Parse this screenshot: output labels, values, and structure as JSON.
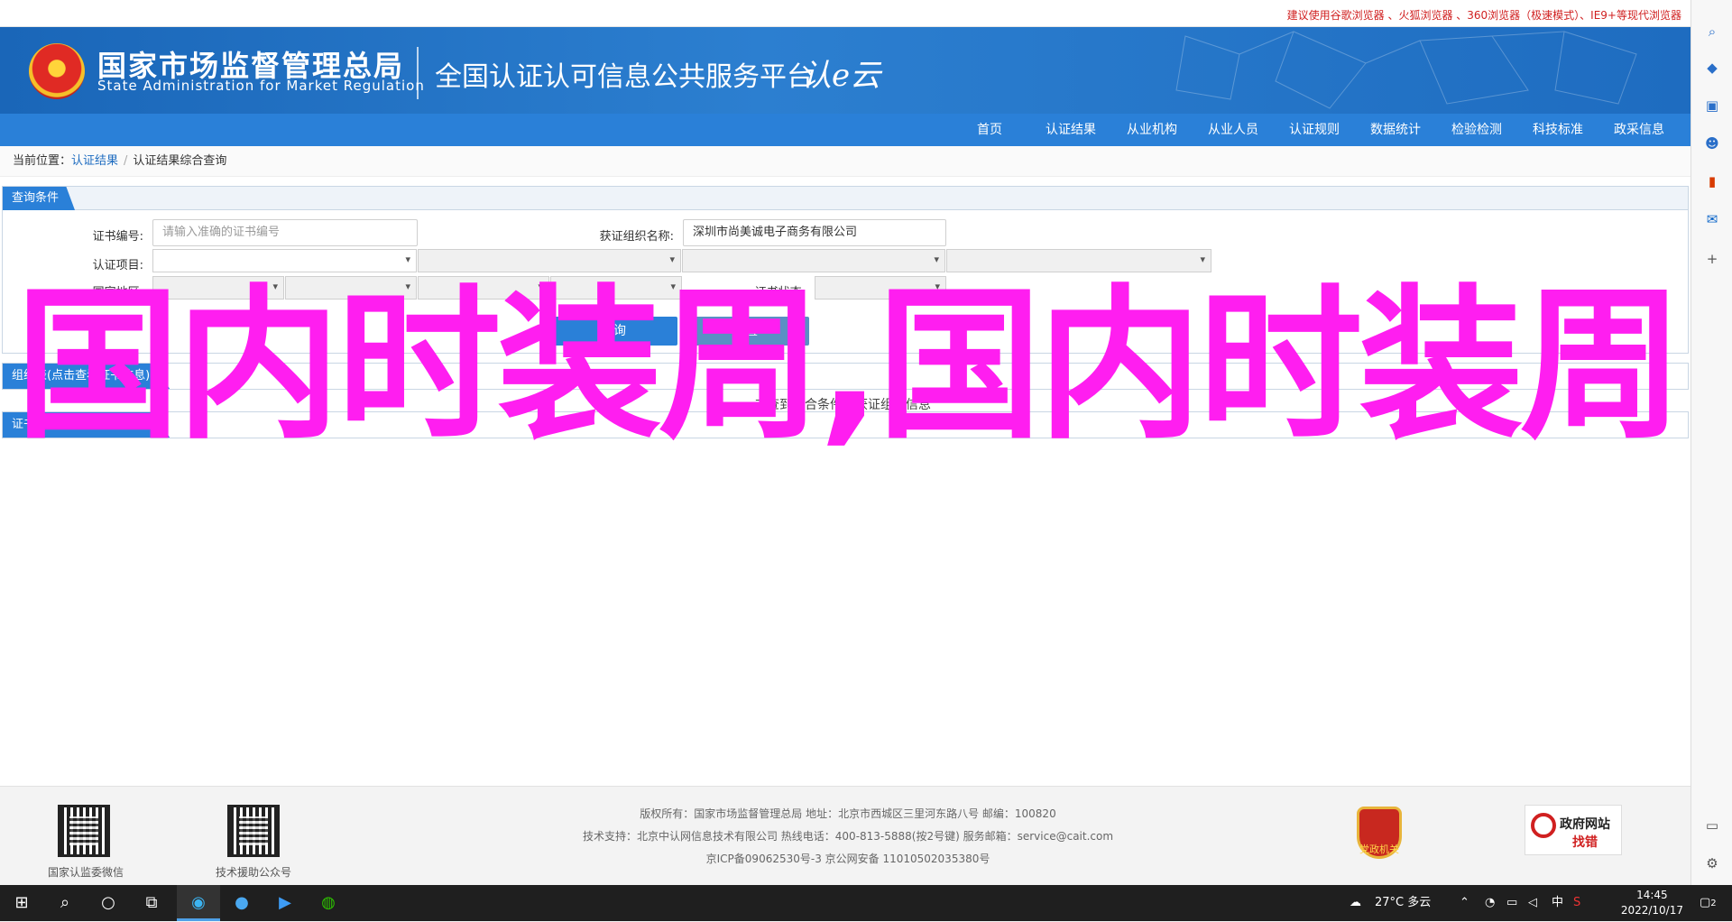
{
  "topbar": {
    "notice": "建议使用谷歌浏览器 、火狐浏览器 、360浏览器（极速模式）、IE9+等现代浏览器"
  },
  "header": {
    "org_cn": "国家市场监督管理总局",
    "org_en": "State Administration  for  Market Regulation",
    "platform": "全国认证认可信息公共服务平台",
    "logo_text": "认e云"
  },
  "nav": [
    "首页",
    "认证结果",
    "从业机构",
    "从业人员",
    "认证规则",
    "数据统计",
    "检验检测",
    "科技标准",
    "政采信息"
  ],
  "breadcrumb": {
    "label": "当前位置：",
    "link": "认证结果",
    "current": "认证结果综合查询"
  },
  "query": {
    "title": "查询条件",
    "cert_no_label": "证书编号:",
    "cert_no_placeholder": "请输入准确的证书编号",
    "org_label": "获证组织名称:",
    "org_value": "深圳市尚美诚电子商务有限公司",
    "project_label": "认证项目:",
    "region_label": "国家地区:",
    "status_label": "证书状态:",
    "search_button": "查询",
    "reset_button": "重置"
  },
  "sections": {
    "org_table_title": "组织表(点击查看证书信息)",
    "cert_table_title": "证书表(点击查看证书信息)",
    "note": "未查到符合条件的获证组织信息"
  },
  "overlay_text": "国内时装周,国内时装周",
  "footer": {
    "qr1_caption": "国家认监委微信",
    "qr2_caption": "技术援助公众号",
    "line1": "版权所有：国家市场监督管理总局    地址：北京市西城区三里河东路八号    邮编：100820",
    "line2": "技术支持：北京中认网信息技术有限公司    热线电话：400-813-5888(按2号键)    服务邮箱：service@cait.com",
    "line3": "京ICP备09062530号-3    京公网安备 11010502035380号",
    "badge_text": "党政机关",
    "gov_badge_t1": "政府网站",
    "gov_badge_t2": "找错"
  },
  "taskbar": {
    "weather": "27°C  多云",
    "ime": "中",
    "time": "14:45",
    "date": "2022/10/17",
    "notifications": "2"
  }
}
